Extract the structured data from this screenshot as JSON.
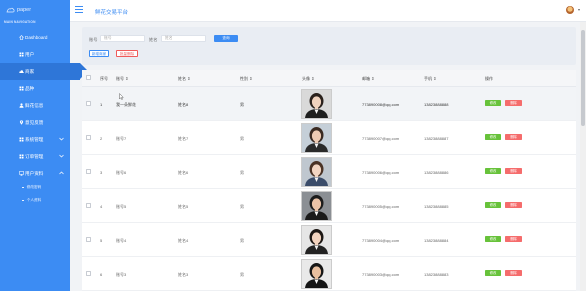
{
  "sidebar": {
    "logo_text": "paper",
    "nav_header": "MAIN NAVIGATION",
    "items": [
      {
        "icon": "home-icon",
        "label": "Dashboard",
        "active": false,
        "expandable": false
      },
      {
        "icon": "grid-icon",
        "label": "用户",
        "active": false,
        "expandable": false
      },
      {
        "icon": "cloud-icon",
        "label": "商家",
        "active": true,
        "expandable": false
      },
      {
        "icon": "grid-icon",
        "label": "品种",
        "active": false,
        "expandable": false
      },
      {
        "icon": "user-icon",
        "label": "鲜花信息",
        "active": false,
        "expandable": false
      },
      {
        "icon": "pin-icon",
        "label": "意见反馈",
        "active": false,
        "expandable": false
      },
      {
        "icon": "grid-icon",
        "label": "系统管理",
        "active": false,
        "expandable": true
      },
      {
        "icon": "grid-icon",
        "label": "订单管理",
        "active": false,
        "expandable": true
      },
      {
        "icon": "desktop-icon",
        "label": "用户资料",
        "active": false,
        "expandable": true,
        "expanded": true
      }
    ],
    "subitems": [
      {
        "label": "修改密码"
      },
      {
        "label": "个人资料"
      }
    ]
  },
  "topbar": {
    "title": "鲜花交易平台"
  },
  "search": {
    "account_label": "账号",
    "account_placeholder": "账号",
    "name_label": "姓名",
    "name_placeholder": "姓名",
    "query_button": "查询",
    "add_button": "新增商家",
    "delete_button": "批量删除"
  },
  "table": {
    "columns": [
      "序号",
      "账号",
      "姓名",
      "性别",
      "头像",
      "邮箱",
      "手机",
      "操作"
    ],
    "edit_label": "修改",
    "delete_label": "删除",
    "rows": [
      {
        "index": "1",
        "account": "我一朵鲜花",
        "name": "姓名8",
        "gender": "男",
        "email": "773890008@qq.com",
        "phone": "13823888888"
      },
      {
        "index": "2",
        "account": "账号7",
        "name": "姓名7",
        "gender": "男",
        "email": "773890007@qq.com",
        "phone": "13823888887"
      },
      {
        "index": "3",
        "account": "账号6",
        "name": "姓名6",
        "gender": "男",
        "email": "773890006@qq.com",
        "phone": "13823888886"
      },
      {
        "index": "4",
        "account": "账号5",
        "name": "姓名5",
        "gender": "男",
        "email": "773890005@qq.com",
        "phone": "13823888885"
      },
      {
        "index": "5",
        "account": "账号4",
        "name": "姓名4",
        "gender": "男",
        "email": "773890004@qq.com",
        "phone": "13823888884"
      },
      {
        "index": "6",
        "account": "账号3",
        "name": "姓名3",
        "gender": "男",
        "email": "773890003@qq.com",
        "phone": "13823888883"
      }
    ]
  },
  "colors": {
    "primary": "#3c8cf3",
    "success": "#67c23a",
    "danger": "#f56c6c"
  }
}
